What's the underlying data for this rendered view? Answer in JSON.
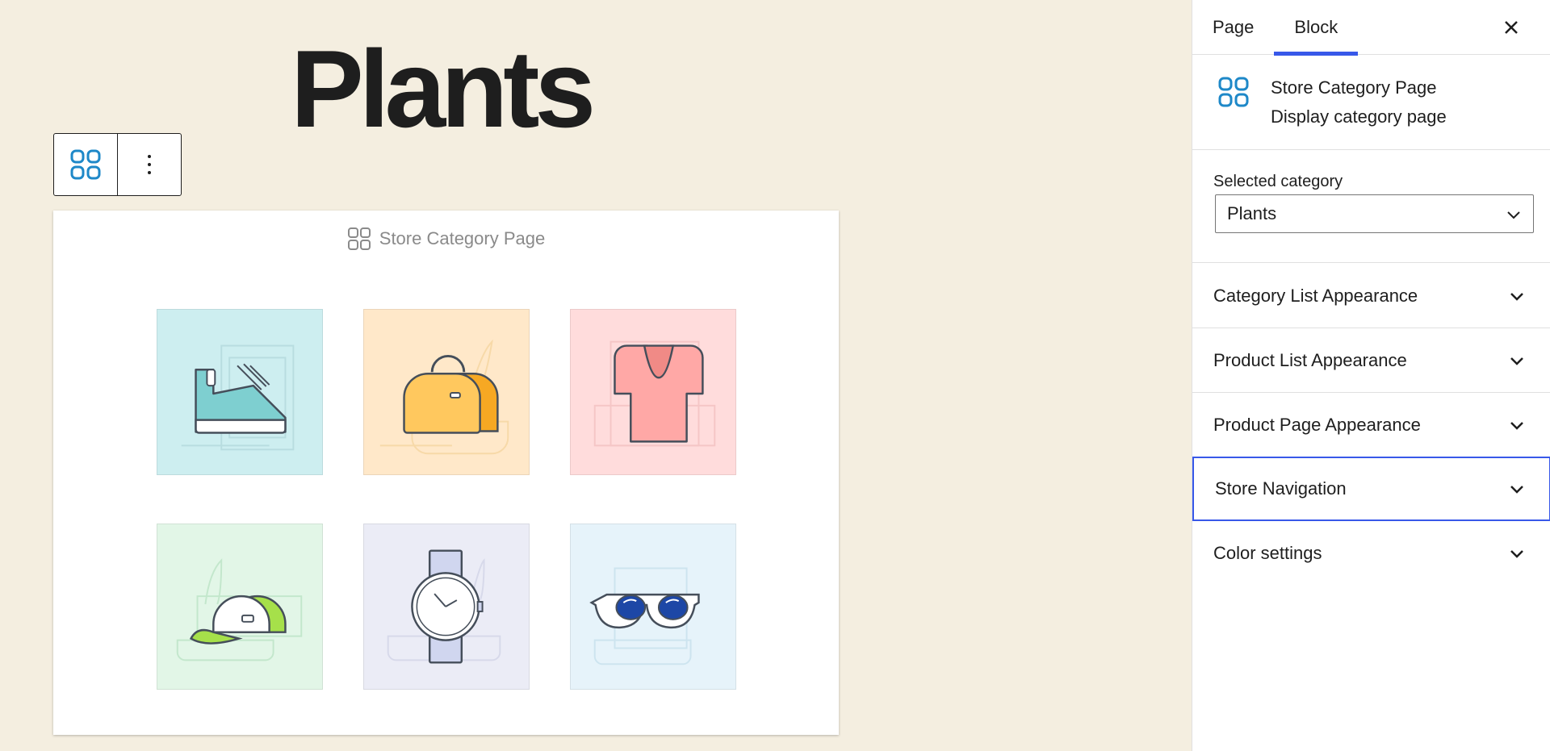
{
  "page_title": "Plants",
  "block_label": "Store Category Page",
  "toolbar": {
    "block_icon": "grid-icon",
    "more_icon": "more-vertical-icon"
  },
  "tiles": [
    {
      "name": "shoe",
      "bg": "#cdeef0"
    },
    {
      "name": "bag",
      "bg": "#ffe8c9"
    },
    {
      "name": "shirt",
      "bg": "#ffdcdc"
    },
    {
      "name": "cap",
      "bg": "#e2f6e7"
    },
    {
      "name": "watch",
      "bg": "#ebecf6"
    },
    {
      "name": "sunglasses",
      "bg": "#e6f3fa"
    }
  ],
  "sidebar": {
    "tabs": [
      "Page",
      "Block"
    ],
    "active_tab": "Block",
    "block_title": "Store Category Page",
    "block_desc": "Display category page",
    "selected_category_label": "Selected category",
    "selected_category_value": "Plants",
    "panels": [
      "Category List Appearance",
      "Product List Appearance",
      "Product Page Appearance",
      "Store Navigation",
      "Color settings"
    ],
    "focused_panel": "Store Navigation"
  },
  "colors": {
    "accent": "#3858e9",
    "icon_blue": "#1e88c8",
    "canvas_bg": "#f4eee0"
  }
}
